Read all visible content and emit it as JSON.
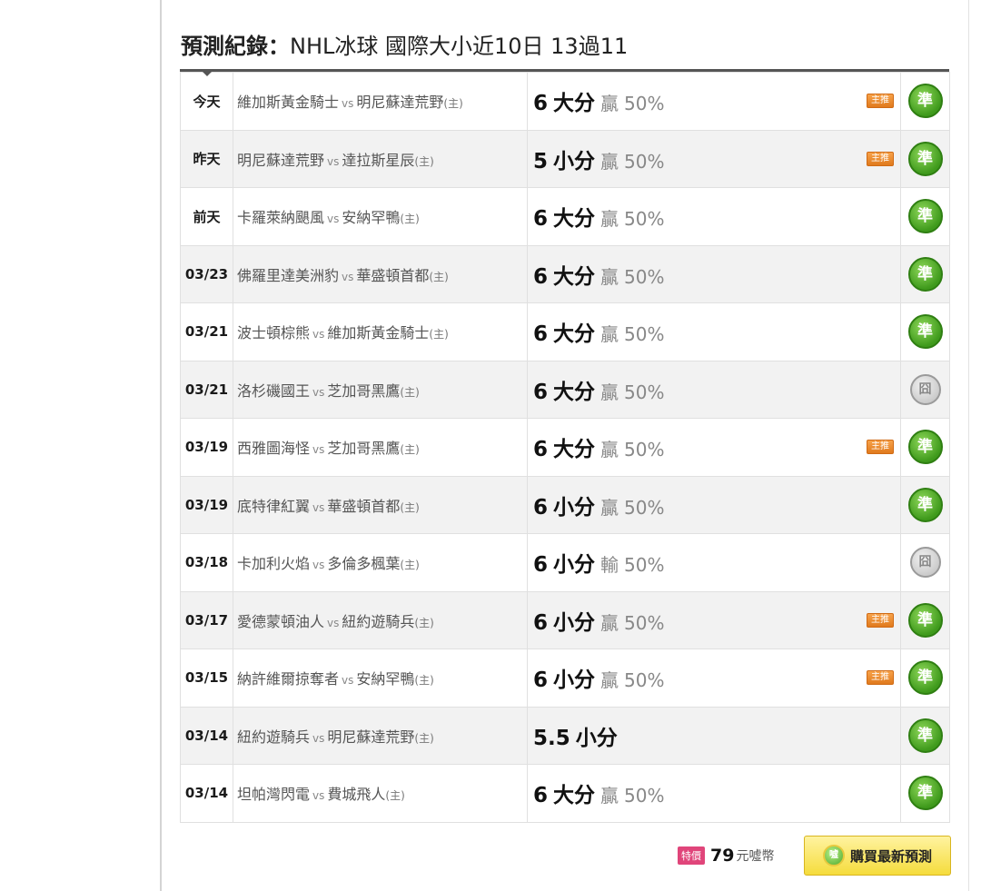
{
  "title": {
    "label": "預測紀錄：",
    "detail": "NHL冰球 國際大小近10日 13過11"
  },
  "rows": [
    {
      "date": "今天",
      "away": "維加斯黃金騎士",
      "vs": "vs",
      "home": "明尼蘇達荒野",
      "host": "(主)",
      "line": "6",
      "dir": "大分",
      "result": "贏",
      "pct": "50%",
      "main": "主推",
      "status": "準",
      "status_type": "hit"
    },
    {
      "date": "昨天",
      "away": "明尼蘇達荒野",
      "vs": "vs",
      "home": "達拉斯星辰",
      "host": "(主)",
      "line": "5",
      "dir": "小分",
      "result": "贏",
      "pct": "50%",
      "main": "主推",
      "status": "準",
      "status_type": "hit"
    },
    {
      "date": "前天",
      "away": "卡羅萊納颶風",
      "vs": "vs",
      "home": "安納罕鴨",
      "host": "(主)",
      "line": "6",
      "dir": "大分",
      "result": "贏",
      "pct": "50%",
      "main": "",
      "status": "準",
      "status_type": "hit"
    },
    {
      "date": "03/23",
      "away": "佛羅里達美洲豹",
      "vs": "vs",
      "home": "華盛頓首都",
      "host": "(主)",
      "line": "6",
      "dir": "大分",
      "result": "贏",
      "pct": "50%",
      "main": "",
      "status": "準",
      "status_type": "hit"
    },
    {
      "date": "03/21",
      "away": "波士頓棕熊",
      "vs": "vs",
      "home": "維加斯黃金騎士",
      "host": "(主)",
      "line": "6",
      "dir": "大分",
      "result": "贏",
      "pct": "50%",
      "main": "",
      "status": "準",
      "status_type": "hit"
    },
    {
      "date": "03/21",
      "away": "洛杉磯國王",
      "vs": "vs",
      "home": "芝加哥黑鷹",
      "host": "(主)",
      "line": "6",
      "dir": "大分",
      "result": "贏",
      "pct": "50%",
      "main": "",
      "status": "囧",
      "status_type": "miss"
    },
    {
      "date": "03/19",
      "away": "西雅圖海怪",
      "vs": "vs",
      "home": "芝加哥黑鷹",
      "host": "(主)",
      "line": "6",
      "dir": "大分",
      "result": "贏",
      "pct": "50%",
      "main": "主推",
      "status": "準",
      "status_type": "hit"
    },
    {
      "date": "03/19",
      "away": "底特律紅翼",
      "vs": "vs",
      "home": "華盛頓首都",
      "host": "(主)",
      "line": "6",
      "dir": "小分",
      "result": "贏",
      "pct": "50%",
      "main": "",
      "status": "準",
      "status_type": "hit"
    },
    {
      "date": "03/18",
      "away": "卡加利火焰",
      "vs": "vs",
      "home": "多倫多楓葉",
      "host": "(主)",
      "line": "6",
      "dir": "小分",
      "result": "輸",
      "pct": "50%",
      "main": "",
      "status": "囧",
      "status_type": "miss"
    },
    {
      "date": "03/17",
      "away": "愛德蒙頓油人",
      "vs": "vs",
      "home": "紐約遊騎兵",
      "host": "(主)",
      "line": "6",
      "dir": "小分",
      "result": "贏",
      "pct": "50%",
      "main": "主推",
      "status": "準",
      "status_type": "hit"
    },
    {
      "date": "03/15",
      "away": "納許維爾掠奪者",
      "vs": "vs",
      "home": "安納罕鴨",
      "host": "(主)",
      "line": "6",
      "dir": "小分",
      "result": "贏",
      "pct": "50%",
      "main": "主推",
      "status": "準",
      "status_type": "hit"
    },
    {
      "date": "03/14",
      "away": "紐約遊騎兵",
      "vs": "vs",
      "home": "明尼蘇達荒野",
      "host": "(主)",
      "line": "5.5",
      "dir": "小分",
      "result": "",
      "pct": "",
      "main": "",
      "status": "準",
      "status_type": "hit"
    },
    {
      "date": "03/14",
      "away": "坦帕灣閃電",
      "vs": "vs",
      "home": "費城飛人",
      "host": "(主)",
      "line": "6",
      "dir": "大分",
      "result": "贏",
      "pct": "50%",
      "main": "",
      "status": "準",
      "status_type": "hit"
    }
  ],
  "purchase": {
    "sale_label": "特價",
    "price": "79",
    "currency": "元噓幣",
    "button_label": "購買最新預測",
    "coin_label": "噓"
  }
}
